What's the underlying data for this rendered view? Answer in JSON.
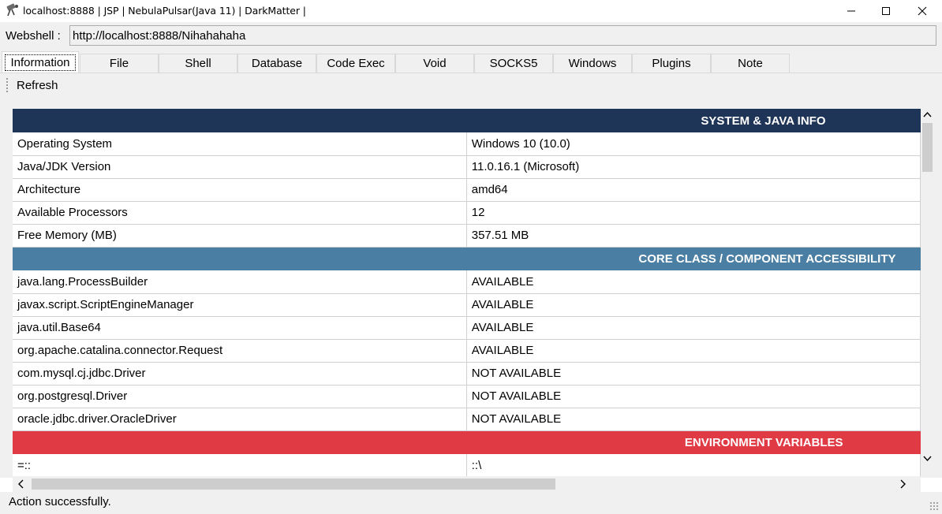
{
  "window": {
    "title": "localhost:8888 | JSP | NebulaPulsar(Java 11) | DarkMatter |",
    "icon": "satellite-icon"
  },
  "urlbar": {
    "label": "Webshell :",
    "value": "http://localhost:8888/Nihahahaha"
  },
  "tabs": [
    {
      "label": "Information",
      "active": true
    },
    {
      "label": "File"
    },
    {
      "label": "Shell"
    },
    {
      "label": "Database"
    },
    {
      "label": "Code Exec"
    },
    {
      "label": "Void"
    },
    {
      "label": "SOCKS5"
    },
    {
      "label": "Windows"
    },
    {
      "label": "Plugins"
    },
    {
      "label": "Note"
    }
  ],
  "toolbar": {
    "refresh_label": "Refresh"
  },
  "sections": {
    "system": {
      "title": "SYSTEM & JAVA INFO",
      "color": "#1e3558",
      "rows": [
        {
          "key": "Operating System",
          "value": "Windows 10 (10.0)"
        },
        {
          "key": "Java/JDK Version",
          "value": "11.0.16.1 (Microsoft)"
        },
        {
          "key": "Architecture",
          "value": "amd64"
        },
        {
          "key": "Available Processors",
          "value": "12"
        },
        {
          "key": "Free Memory (MB)",
          "value": "357.51 MB"
        }
      ]
    },
    "core": {
      "title": "CORE CLASS / COMPONENT ACCESSIBILITY",
      "color": "#4a7fa3",
      "rows": [
        {
          "key": "java.lang.ProcessBuilder",
          "value": "AVAILABLE"
        },
        {
          "key": "javax.script.ScriptEngineManager",
          "value": "AVAILABLE"
        },
        {
          "key": "java.util.Base64",
          "value": "AVAILABLE"
        },
        {
          "key": "org.apache.catalina.connector.Request",
          "value": "AVAILABLE"
        },
        {
          "key": "com.mysql.cj.jdbc.Driver",
          "value": "NOT AVAILABLE"
        },
        {
          "key": "org.postgresql.Driver",
          "value": "NOT AVAILABLE"
        },
        {
          "key": "oracle.jdbc.driver.OracleDriver",
          "value": "NOT AVAILABLE"
        }
      ]
    },
    "env": {
      "title": "ENVIRONMENT VARIABLES",
      "color": "#e03a45",
      "rows": [
        {
          "key": "=::",
          "value": "::\\"
        }
      ]
    }
  },
  "status": {
    "text": "Action successfully."
  }
}
